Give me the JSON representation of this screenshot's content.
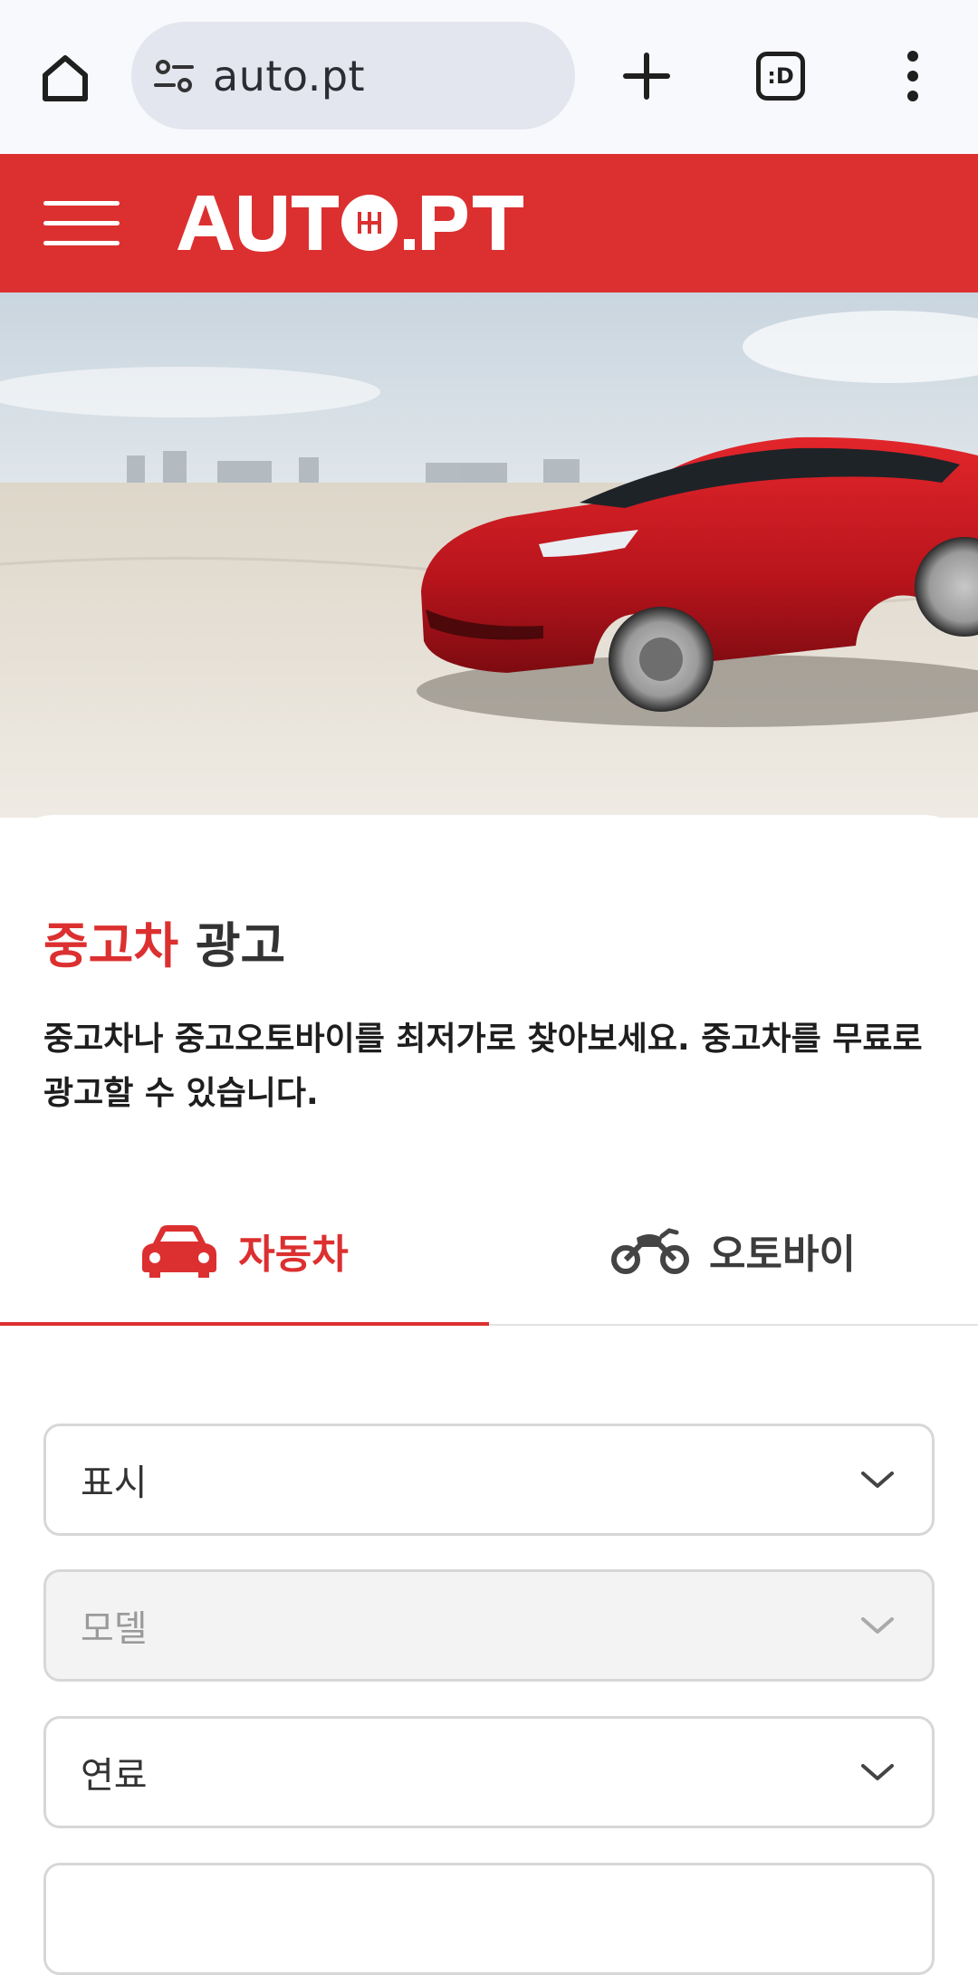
{
  "browser": {
    "url": "auto.pt",
    "tabs_icon_text": ":D"
  },
  "site": {
    "logo_text": "AUTO.PT",
    "brand_color": "#dc3030"
  },
  "hero": {
    "image": "red-sedan-photo"
  },
  "main": {
    "headline_accent": "중고차",
    "headline_rest": " 광고",
    "intro": "중고차나 중고오토바이를 최저가로 찾아보세요. 중고차를 무료로 광고할 수 있습니다.",
    "tabs": [
      {
        "label": "자동차",
        "icon": "car-icon",
        "active": true
      },
      {
        "label": "오토바이",
        "icon": "motorcycle-icon",
        "active": false
      }
    ],
    "selects": [
      {
        "placeholder": "표시",
        "disabled": false
      },
      {
        "placeholder": "모델",
        "disabled": true
      },
      {
        "placeholder": "연료",
        "disabled": false
      },
      {
        "placeholder": "",
        "disabled": false
      }
    ]
  }
}
